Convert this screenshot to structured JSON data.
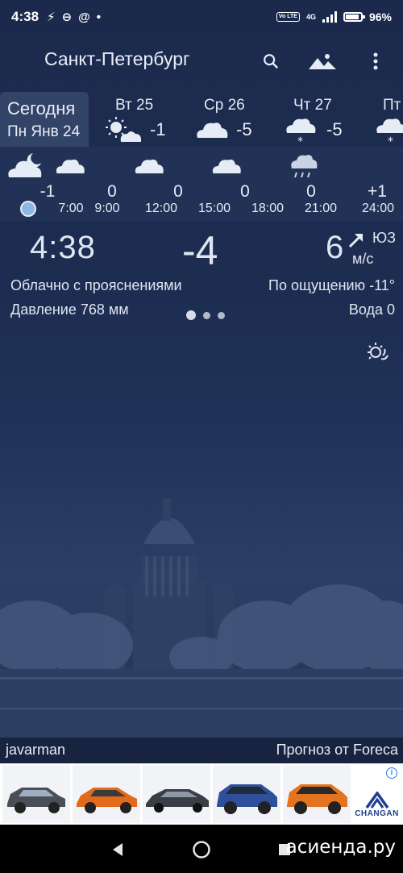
{
  "status_bar": {
    "time": "4:38",
    "left_icons": [
      "lightning-icon",
      "link-icon",
      "at-icon",
      "dot-icon"
    ],
    "volte": "Vo LTE",
    "network": "4G",
    "battery": "96%"
  },
  "app_bar": {
    "city": "Санкт-Петербург",
    "icons": [
      "search-icon",
      "mountains-icon",
      "more-vert-icon"
    ]
  },
  "days": {
    "today": {
      "line1": "Сегодня",
      "line2": "Пн Янв 24"
    },
    "items": [
      {
        "name": "Вт 25",
        "temp": "-1",
        "icon": "sun-cloud-icon"
      },
      {
        "name": "Ср 26",
        "temp": "-5",
        "icon": "cloud-icon"
      },
      {
        "name": "Чт 27",
        "temp": "-5",
        "icon": "snow-cloud-icon"
      },
      {
        "name": "Пт",
        "temp": "",
        "icon": "snow-cloud-icon"
      }
    ]
  },
  "hourly": {
    "temps": [
      "-1",
      "0",
      "0",
      "0",
      "0",
      "+1"
    ],
    "times": [
      "7:00",
      "9:00",
      "12:00",
      "15:00",
      "18:00",
      "21:00",
      "24:00"
    ],
    "icons": [
      "moon-cloud-icon",
      "cloud-icon",
      "cloud-icon",
      "cloud-icon",
      "cloud-icon",
      "sleet-cloud-icon"
    ]
  },
  "current": {
    "time": "4:38",
    "temp": "-4",
    "wind_speed": "6",
    "wind_dir": "ЮЗ",
    "wind_unit": "м/с",
    "condition": "Облачно с прояснениями",
    "feels_like": "По ощущению -11°",
    "pressure": "Давление 768 мм",
    "water": "Вода 0"
  },
  "footer": {
    "author": "javarman",
    "provider": "Прогноз от Foreca"
  },
  "ad": {
    "brand": "CHANGAN",
    "car_colors": [
      "#4a4e57",
      "#e36a1c",
      "#3a3d44",
      "#2f4f9a",
      "#e3731f"
    ]
  },
  "watermark": "асиенда.ру"
}
